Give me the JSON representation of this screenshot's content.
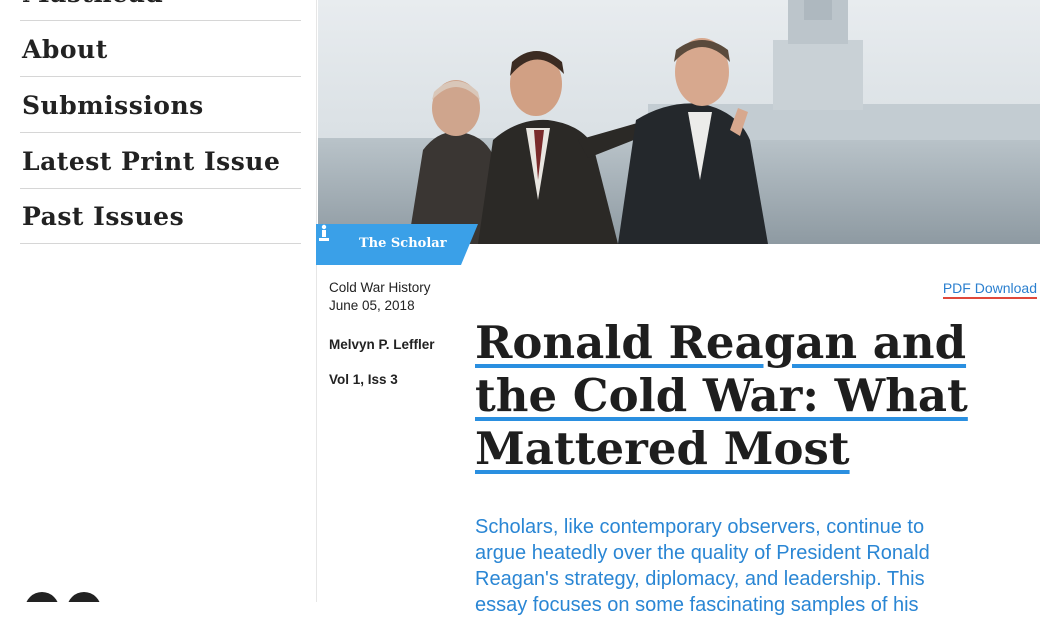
{
  "sidebar": {
    "items": [
      {
        "label": "Masthead"
      },
      {
        "label": "About"
      },
      {
        "label": "Submissions"
      },
      {
        "label": "Latest Print Issue"
      },
      {
        "label": "Past Issues"
      }
    ]
  },
  "article": {
    "section_tag": "The Scholar",
    "topic": "Cold War History",
    "date": "June 05, 2018",
    "author": "Melvyn P. Leffler",
    "volume": "Vol 1, Iss 3",
    "pdf_link": "PDF Download",
    "title": "Ronald Reagan and the Cold War: What Mattered Most",
    "abstract": "Scholars, like contemporary observers, continue to argue heatedly over the quality of President Ronald Reagan's strategy, diplomacy, and leadership. This essay focuses on some fascinating samples of his"
  },
  "colors": {
    "accent_blue": "#2a8fe0",
    "tag_blue": "#3aa0e8",
    "pdf_underline": "#e0483a",
    "abstract_text": "#2a86d4"
  }
}
